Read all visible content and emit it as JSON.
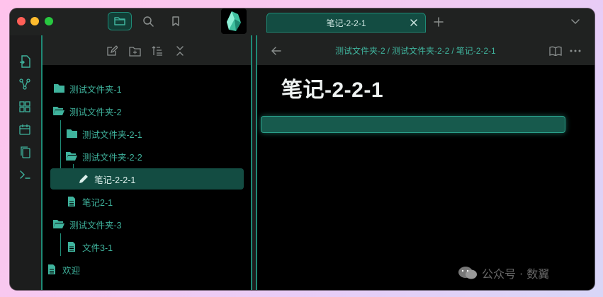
{
  "titlebar": {
    "buttons": [
      "file-explorer",
      "search",
      "bookmarks"
    ],
    "tab": {
      "title": "笔记-2-2-1"
    }
  },
  "ribbon": {
    "icons": [
      "open-quick-switcher-icon",
      "graph-view-icon",
      "canvas-icon",
      "daily-note-icon",
      "templates-icon",
      "command-palette-icon"
    ]
  },
  "sidebar": {
    "actions": [
      "new-note",
      "new-folder",
      "sort",
      "collapse-all"
    ],
    "tree": [
      {
        "label": "测试文件夹-1",
        "icon": "folder",
        "depth": 0
      },
      {
        "label": "测试文件夹-2",
        "icon": "folder-open",
        "depth": 0
      },
      {
        "label": "测试文件夹-2-1",
        "icon": "folder",
        "depth": 1
      },
      {
        "label": "测试文件夹-2-2",
        "icon": "folder-open",
        "depth": 1
      },
      {
        "label": "笔记-2-2-1",
        "icon": "pencil",
        "depth": 2,
        "selected": true
      },
      {
        "label": "笔记2-1",
        "icon": "file",
        "depth": 1
      },
      {
        "label": "测试文件夹-3",
        "icon": "folder-open",
        "depth": 0
      },
      {
        "label": "文件3-1",
        "icon": "file",
        "depth": 1
      },
      {
        "label": "欢迎",
        "icon": "file",
        "depth": 0
      }
    ]
  },
  "main": {
    "breadcrumb": [
      "测试文件夹-2",
      "测试文件夹-2-2",
      "笔记-2-2-1"
    ],
    "breadcrumb_sep": "/",
    "title": "笔记-2-2-1"
  },
  "watermark": {
    "text": "公众号 · 数翼"
  },
  "colors": {
    "accent": "#1f8a76",
    "accent_text": "#3fb39d",
    "selected_bg": "#134c42"
  }
}
